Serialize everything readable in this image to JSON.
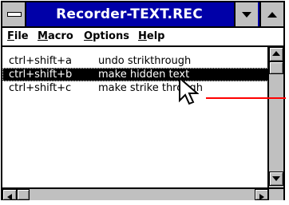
{
  "window": {
    "title": "Recorder-TEXT.REC"
  },
  "menu": {
    "items": [
      {
        "label": "File"
      },
      {
        "label": "Macro"
      },
      {
        "label": "Options"
      },
      {
        "label": "Help"
      }
    ]
  },
  "list": {
    "rows": [
      {
        "key": "ctrl+shift+a",
        "action": "undo strikthrough",
        "selected": false
      },
      {
        "key": "ctrl+shift+b",
        "action": "make hidden text",
        "selected": true
      },
      {
        "key": "ctrl+shift+c",
        "action": "make strike through",
        "selected": false
      }
    ]
  },
  "icons": {
    "system_menu": "system-menu-icon",
    "minimize": "minimize-arrow-icon",
    "maximize": "maximize-arrow-icon",
    "scroll_up": "scroll-up-arrow-icon",
    "scroll_down": "scroll-down-arrow-icon",
    "scroll_left": "scroll-left-arrow-icon",
    "scroll_right": "scroll-right-arrow-icon",
    "cursor": "arrow-pointer-icon"
  },
  "colors": {
    "titlebar": "#0000a8",
    "selection": "#000000",
    "annotation_line": "#ff0000",
    "chrome": "#c0c0c0"
  }
}
